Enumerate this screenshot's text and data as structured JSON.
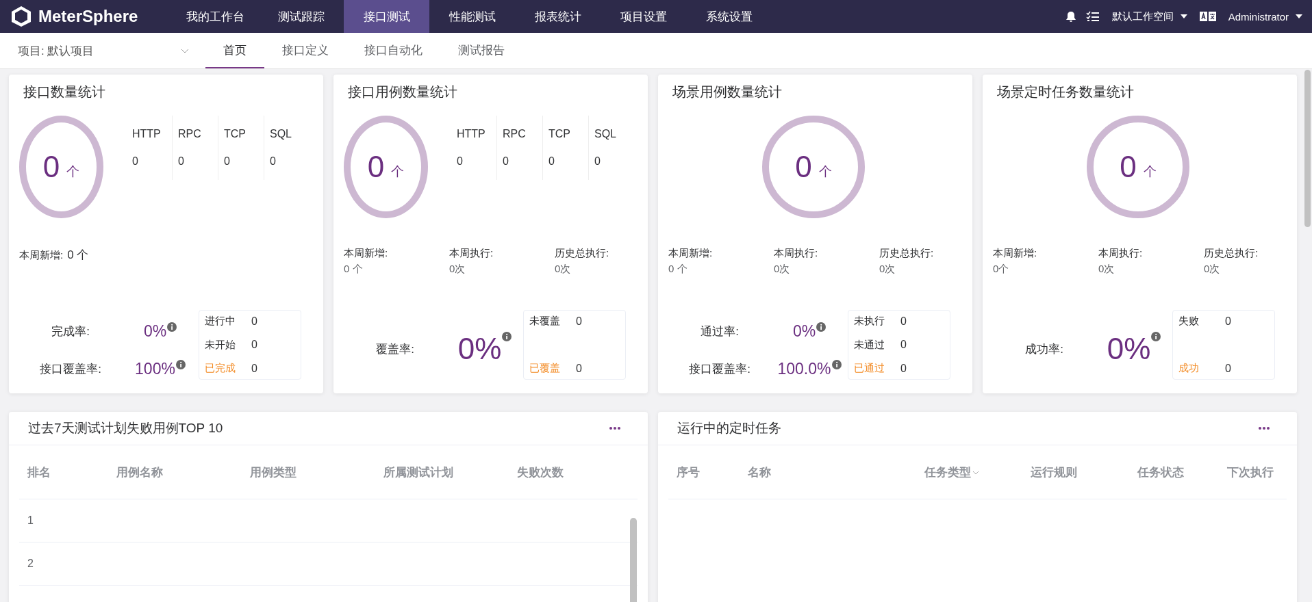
{
  "brand": {
    "name": "MeterSphere"
  },
  "top_nav": [
    {
      "label": "我的工作台",
      "selected": false
    },
    {
      "label": "测试跟踪",
      "selected": false
    },
    {
      "label": "接口测试",
      "selected": true
    },
    {
      "label": "性能测试",
      "selected": false
    },
    {
      "label": "报表统计",
      "selected": false
    },
    {
      "label": "项目设置",
      "selected": false
    },
    {
      "label": "系统设置",
      "selected": false
    }
  ],
  "workspace": "默认工作空间",
  "user": "Administrator",
  "project_select": "项目: 默认项目",
  "sub_nav": [
    {
      "label": "首页",
      "selected": true
    },
    {
      "label": "接口定义",
      "selected": false
    },
    {
      "label": "接口自动化",
      "selected": false
    },
    {
      "label": "测试报告",
      "selected": false
    }
  ],
  "cards": [
    {
      "title": "接口数量统计",
      "ring": {
        "value": "0",
        "unit": "个"
      },
      "protocols": [
        {
          "name": "HTTP",
          "count": "0"
        },
        {
          "name": "RPC",
          "count": "0"
        },
        {
          "name": "TCP",
          "count": "0"
        },
        {
          "name": "SQL",
          "count": "0"
        }
      ],
      "stats": [
        {
          "label": "本周新增:",
          "value": "0 个",
          "kind": "inline"
        }
      ],
      "rates": [
        {
          "label": "完成率:",
          "value": "0%"
        },
        {
          "label": "接口覆盖率:",
          "value": "100%"
        }
      ],
      "status": [
        {
          "label": "进行中",
          "value": "0",
          "highlight": false
        },
        {
          "label": "未开始",
          "value": "0",
          "highlight": false
        },
        {
          "label": "已完成",
          "value": "0",
          "highlight": true
        }
      ]
    },
    {
      "title": "接口用例数量统计",
      "ring": {
        "value": "0",
        "unit": "个"
      },
      "protocols": [
        {
          "name": "HTTP",
          "count": "0"
        },
        {
          "name": "RPC",
          "count": "0"
        },
        {
          "name": "TCP",
          "count": "0"
        },
        {
          "name": "SQL",
          "count": "0"
        }
      ],
      "stats": [
        {
          "label": "本周新增:",
          "value": "0 个",
          "kind": "stacked"
        },
        {
          "label": "本周执行:",
          "value": "0次",
          "kind": "stacked"
        },
        {
          "label": "历史总执行:",
          "value": "0次",
          "kind": "stacked"
        }
      ],
      "rates": [
        {
          "label": "覆盖率:",
          "value": "0%"
        }
      ],
      "status": [
        {
          "label": "未覆盖",
          "value": "0",
          "highlight": false
        },
        {
          "label": "已覆盖",
          "value": "0",
          "highlight": true
        }
      ]
    },
    {
      "title": "场景用例数量统计",
      "ring": {
        "value": "0",
        "unit": "个"
      },
      "stats": [
        {
          "label": "本周新增:",
          "value": "0 个",
          "kind": "stacked"
        },
        {
          "label": "本周执行:",
          "value": "0次",
          "kind": "stacked"
        },
        {
          "label": "历史总执行:",
          "value": "0次",
          "kind": "stacked"
        }
      ],
      "rates": [
        {
          "label": "通过率:",
          "value": "0%"
        },
        {
          "label": "接口覆盖率:",
          "value": "100.0%"
        }
      ],
      "status": [
        {
          "label": "未执行",
          "value": "0",
          "highlight": false
        },
        {
          "label": "未通过",
          "value": "0",
          "highlight": false
        },
        {
          "label": "已通过",
          "value": "0",
          "highlight": true
        }
      ]
    },
    {
      "title": "场景定时任务数量统计",
      "ring": {
        "value": "0",
        "unit": "个"
      },
      "stats": [
        {
          "label": "本周新增:",
          "value": "0个",
          "kind": "stacked"
        },
        {
          "label": "本周执行:",
          "value": "0次",
          "kind": "stacked"
        },
        {
          "label": "历史总执行:",
          "value": "0次",
          "kind": "stacked"
        }
      ],
      "rates": [
        {
          "label": "成功率:",
          "value": "0%"
        }
      ],
      "status": [
        {
          "label": "失败",
          "value": "0",
          "highlight": false
        },
        {
          "label": "成功",
          "value": "0",
          "highlight": true
        }
      ]
    }
  ],
  "panels": [
    {
      "title": "过去7天测试计划失败用例TOP 10",
      "columns": [
        {
          "label": "排名",
          "sortable": false
        },
        {
          "label": "用例名称",
          "sortable": false
        },
        {
          "label": "用例类型",
          "sortable": false
        },
        {
          "label": "所属测试计划",
          "sortable": false
        },
        {
          "label": "失败次数",
          "sortable": false
        }
      ],
      "rows": [
        [
          "1"
        ],
        [
          "2"
        ]
      ]
    },
    {
      "title": "运行中的定时任务",
      "columns": [
        {
          "label": "序号",
          "sortable": false
        },
        {
          "label": "名称",
          "sortable": false
        },
        {
          "label": "任务类型",
          "sortable": true
        },
        {
          "label": "运行规则",
          "sortable": false
        },
        {
          "label": "任务状态",
          "sortable": false
        },
        {
          "label": "下次执行",
          "sortable": false
        }
      ]
    }
  ]
}
